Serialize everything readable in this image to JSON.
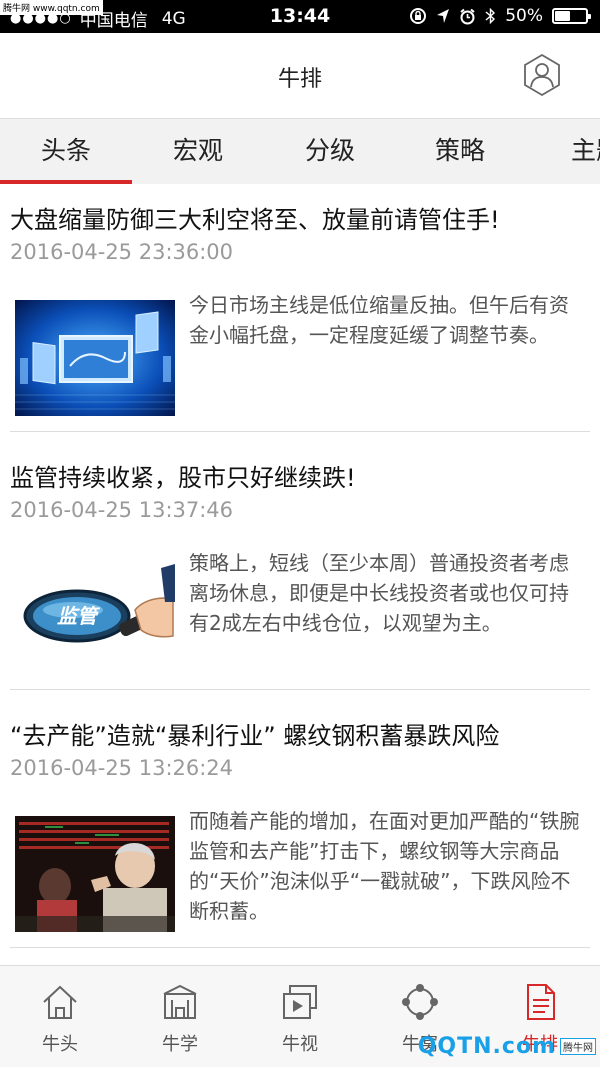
{
  "watermark_top": "腾牛网 www.qqtn.com",
  "status_bar": {
    "carrier": "中国电信",
    "network": "4G",
    "time": "13:44",
    "battery": "50%",
    "battery_level": 0.5
  },
  "header": {
    "title": "牛排"
  },
  "tabs": [
    {
      "label": "头条"
    },
    {
      "label": "宏观"
    },
    {
      "label": "分级"
    },
    {
      "label": "策略"
    },
    {
      "label": "主题"
    }
  ],
  "articles": [
    {
      "headline": "大盘缩量防御三大利空将至、放量前请管住手!",
      "date": "2016-04-25 23:36:00",
      "summary": "今日市场主线是低位缩量反抽。但午后有资金小幅托盘，一定程度延缓了调整节奏。"
    },
    {
      "headline": "监管持续收紧，股市只好继续跌!",
      "date": "2016-04-25 13:37:46",
      "summary": "策略上，短线（至少本周）普通投资者考虑离场休息，即便是中长线投资者或也仅可持有2成左右中线仓位，以观望为主。",
      "thumb_text": "监管"
    },
    {
      "headline": "“去产能”造就“暴利行业”  螺纹钢积蓄暴跌风险",
      "date": "2016-04-25 13:26:24",
      "summary": "而随着产能的增加，在面对更加严酷的“铁腕监管和去产能”打击下，螺纹钢等大宗商品的“天价”泡沫似乎“一戳就破”，下跌风险不断积蓄。"
    }
  ],
  "bottom_nav": [
    {
      "label": "牛头"
    },
    {
      "label": "牛学"
    },
    {
      "label": "牛视"
    },
    {
      "label": "牛窝"
    },
    {
      "label": "牛排"
    }
  ],
  "watermark_bottom": {
    "text": "QQTN.com",
    "tag": "腾牛网"
  },
  "colors": {
    "accent": "#d62828",
    "tab_bg": "#f2f2f2",
    "date": "#9a9a9a"
  }
}
